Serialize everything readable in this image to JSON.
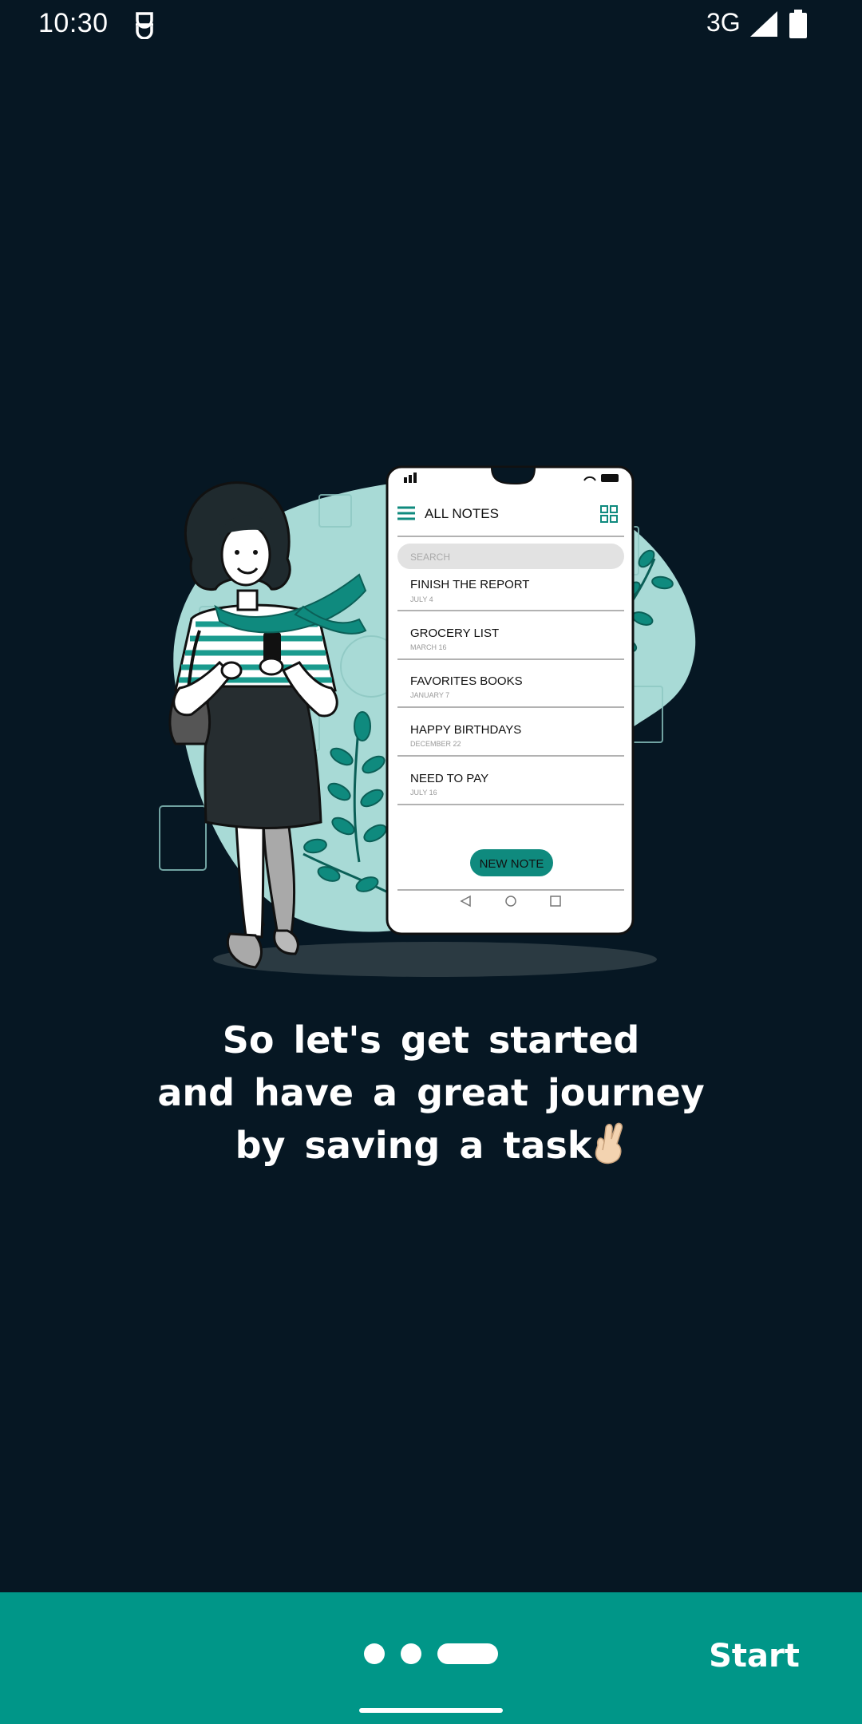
{
  "status_bar": {
    "time": "10:30",
    "network": "3G",
    "notification_icon": "notification-app-icon",
    "signal_icon": "signal-icon",
    "battery_icon": "battery-icon"
  },
  "illustration": {
    "phone": {
      "header_title": "ALL NOTES",
      "search_placeholder": "SEARCH",
      "notes": [
        {
          "title": "FINISH THE REPORT",
          "date": "JULY 4"
        },
        {
          "title": "GROCERY LIST",
          "date": "MARCH 16"
        },
        {
          "title": "FAVORITES BOOKS",
          "date": "JANUARY 7"
        },
        {
          "title": "HAPPY BIRTHDAYS",
          "date": "DECEMBER 22"
        },
        {
          "title": "NEED TO PAY",
          "date": "JULY 16"
        }
      ],
      "new_note_label": "NEW NOTE"
    }
  },
  "onboarding": {
    "message_lines": [
      "So let's get started",
      "and have a great journey",
      "by saving a task"
    ],
    "emoji": "crossed-fingers-emoji"
  },
  "pager": {
    "page_count": 3,
    "current_page": 3
  },
  "bottom_bar": {
    "start_label": "Start"
  },
  "colors": {
    "background": "#061723",
    "accent": "#009688",
    "illustration_blob": "#a8dad6",
    "leaf": "#0f8a7e"
  }
}
